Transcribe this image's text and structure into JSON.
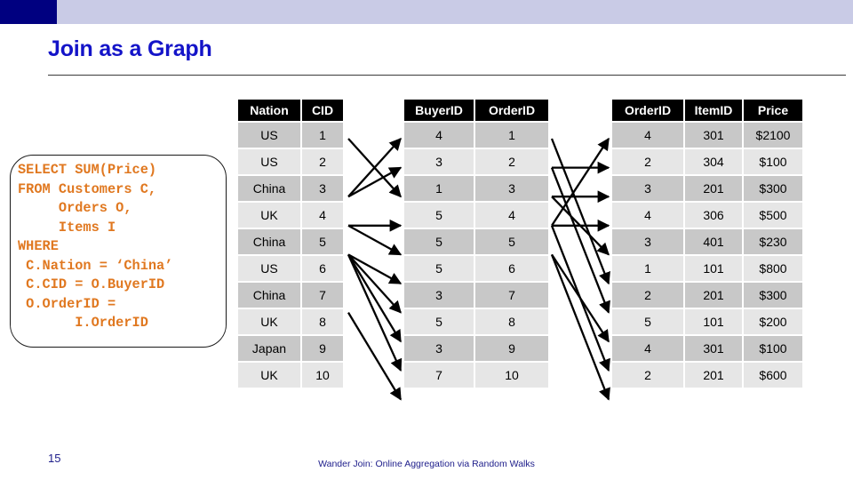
{
  "slide": {
    "title": "Join as a Graph",
    "number": "15",
    "footer_caption": "Wander Join: Online Aggregation via Random Walks",
    "accent_color": "#1414c8",
    "topbar_dark_color": "#000080",
    "topbar_light_color": "#c9cbe6",
    "sql_color": "#e07820",
    "header_bg_color": "#000000",
    "row_odd_color": "#c8c8c8",
    "row_even_color": "#e6e6e6"
  },
  "sql": {
    "lines": [
      "SELECT SUM(Price)",
      "FROM Customers C,",
      "     Orders O,",
      "     Items I",
      "WHERE",
      " C.Nation = ‘China’",
      " C.CID = O.BuyerID",
      " O.OrderID =",
      "       I.OrderID"
    ],
    "text": "SELECT SUM(Price)\nFROM Customers C,\n     Orders O,\n     Items I\nWHERE\n C.Nation = ‘China’\n C.CID = O.BuyerID\n O.OrderID =\n       I.OrderID"
  },
  "tables": {
    "customers": {
      "name": "Customers",
      "columns": [
        "Nation",
        "CID"
      ],
      "rows": [
        [
          "US",
          "1"
        ],
        [
          "US",
          "2"
        ],
        [
          "China",
          "3"
        ],
        [
          "UK",
          "4"
        ],
        [
          "China",
          "5"
        ],
        [
          "US",
          "6"
        ],
        [
          "China",
          "7"
        ],
        [
          "UK",
          "8"
        ],
        [
          "Japan",
          "9"
        ],
        [
          "UK",
          "10"
        ]
      ]
    },
    "orders": {
      "name": "Orders",
      "columns": [
        "BuyerID",
        "OrderID"
      ],
      "rows": [
        [
          "4",
          "1"
        ],
        [
          "3",
          "2"
        ],
        [
          "1",
          "3"
        ],
        [
          "5",
          "4"
        ],
        [
          "5",
          "5"
        ],
        [
          "5",
          "6"
        ],
        [
          "3",
          "7"
        ],
        [
          "5",
          "8"
        ],
        [
          "3",
          "9"
        ],
        [
          "7",
          "10"
        ]
      ]
    },
    "items": {
      "name": "Items",
      "columns": [
        "OrderID",
        "ItemID",
        "Price"
      ],
      "rows": [
        [
          "4",
          "301",
          "$2100"
        ],
        [
          "2",
          "304",
          "$100"
        ],
        [
          "3",
          "201",
          "$300"
        ],
        [
          "4",
          "306",
          "$500"
        ],
        [
          "3",
          "401",
          "$230"
        ],
        [
          "1",
          "101",
          "$800"
        ],
        [
          "2",
          "201",
          "$300"
        ],
        [
          "5",
          "101",
          "$200"
        ],
        [
          "4",
          "301",
          "$100"
        ],
        [
          "2",
          "201",
          "$600"
        ]
      ]
    }
  },
  "graph_edges": {
    "customers_to_orders": [
      {
        "from_row": 1,
        "to_row": 3
      },
      {
        "from_row": 3,
        "to_row": 1
      },
      {
        "from_row": 3,
        "to_row": 2
      },
      {
        "from_row": 4,
        "to_row": 4
      },
      {
        "from_row": 4,
        "to_row": 5
      },
      {
        "from_row": 5,
        "to_row": 6
      },
      {
        "from_row": 5,
        "to_row": 7
      },
      {
        "from_row": 5,
        "to_row": 8
      },
      {
        "from_row": 5,
        "to_row": 9
      },
      {
        "from_row": 7,
        "to_row": 10
      }
    ],
    "orders_to_items": [
      {
        "from_row": 1,
        "to_row": 6
      },
      {
        "from_row": 2,
        "to_row": 2
      },
      {
        "from_row": 2,
        "to_row": 7
      },
      {
        "from_row": 3,
        "to_row": 3
      },
      {
        "from_row": 3,
        "to_row": 5
      },
      {
        "from_row": 4,
        "to_row": 1
      },
      {
        "from_row": 4,
        "to_row": 4
      },
      {
        "from_row": 4,
        "to_row": 9
      },
      {
        "from_row": 5,
        "to_row": 8
      },
      {
        "from_row": 5,
        "to_row": 10
      }
    ]
  }
}
